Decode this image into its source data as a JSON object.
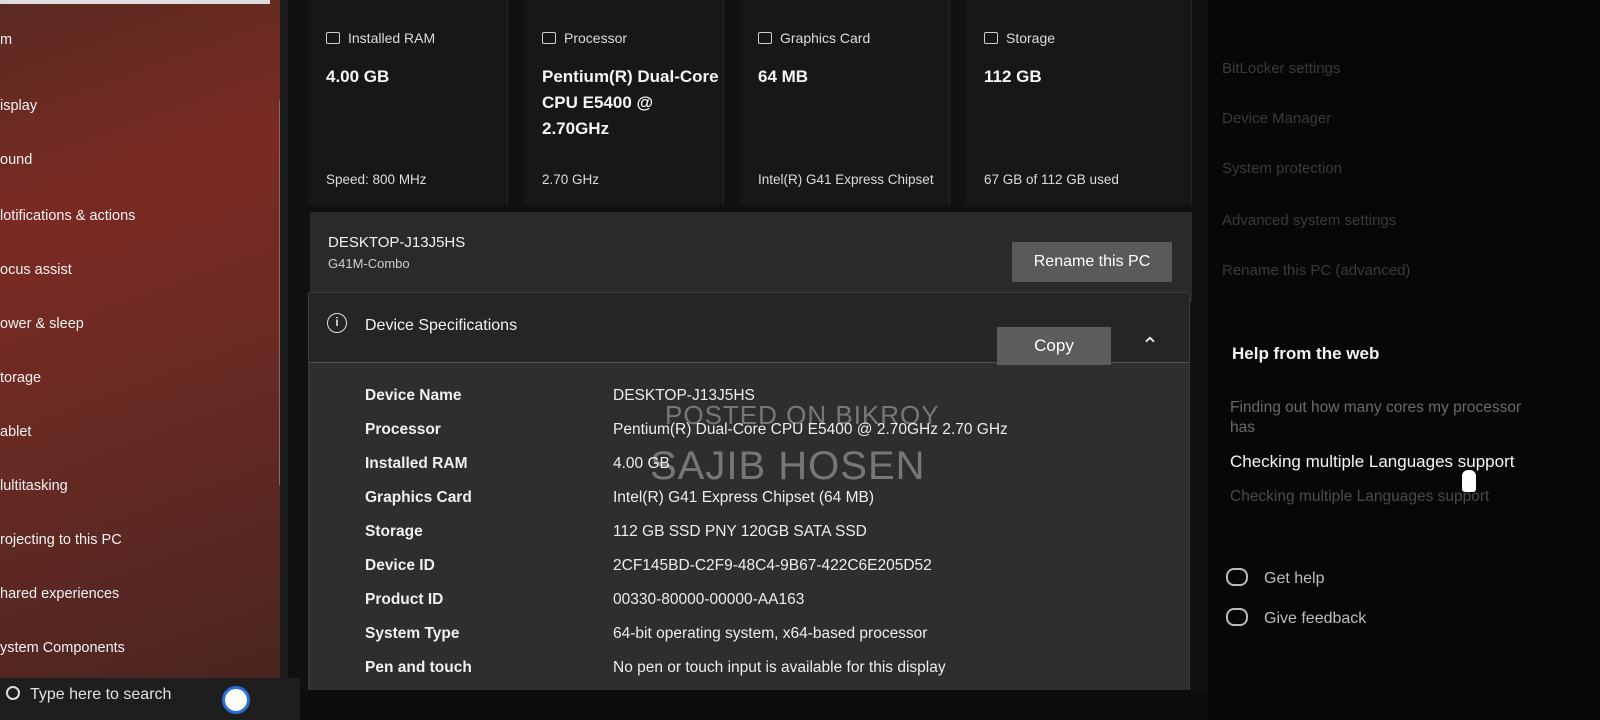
{
  "sidebar": {
    "items": [
      {
        "label": "m"
      },
      {
        "label": "isplay"
      },
      {
        "label": "ound"
      },
      {
        "label": "lotifications & actions"
      },
      {
        "label": "ocus assist"
      },
      {
        "label": "ower & sleep"
      },
      {
        "label": "torage"
      },
      {
        "label": "ablet"
      },
      {
        "label": "lultitasking"
      },
      {
        "label": "rojecting to this PC"
      },
      {
        "label": "hared experiences"
      },
      {
        "label": "ystem Components"
      }
    ]
  },
  "cards": [
    {
      "header": "Installed RAM",
      "value": "4.00 GB",
      "sub": "Speed: 800 MHz",
      "icon": "ram-icon"
    },
    {
      "header": "Processor",
      "value": "Pentium(R) Dual-Core CPU E5400 @ 2.70GHz",
      "sub": "2.70 GHz",
      "icon": "cpu-icon"
    },
    {
      "header": "Graphics Card",
      "value": "64 MB",
      "sub": "Intel(R) G41 Express Chipset",
      "icon": "gpu-icon"
    },
    {
      "header": "Storage",
      "value": "112 GB",
      "sub": "67 GB of 112 GB used",
      "icon": "storage-icon"
    }
  ],
  "pc": {
    "name": "DESKTOP-J13J5HS",
    "model": "G41M-Combo",
    "rename_label": "Rename this PC"
  },
  "specs": {
    "title": "Device Specifications",
    "copy_label": "Copy",
    "rows": [
      {
        "key": "Device Name",
        "value": "DESKTOP-J13J5HS"
      },
      {
        "key": "Processor",
        "value": "Pentium(R) Dual-Core  CPU     E5400  @ 2.70GHz   2.70 GHz"
      },
      {
        "key": "Installed RAM",
        "value": "4.00 GB"
      },
      {
        "key": "Graphics Card",
        "value": "Intel(R) G41 Express Chipset (64 MB)"
      },
      {
        "key": "Storage",
        "value": "112 GB SSD PNY 120GB SATA SSD"
      },
      {
        "key": "Device ID",
        "value": "2CF145BD-C2F9-48C4-9B67-422C6E205D52"
      },
      {
        "key": "Product ID",
        "value": "00330-80000-00000-AA163"
      },
      {
        "key": "System Type",
        "value": "64-bit operating system, x64-based processor"
      },
      {
        "key": "Pen and touch",
        "value": "No pen or touch input is available for this display"
      }
    ]
  },
  "right": {
    "faint_links": [
      "BitLocker settings",
      "Device Manager",
      "System protection",
      "Advanced system settings",
      "Rename this PC (advanced)"
    ],
    "help_title": "Help from the web",
    "links": [
      {
        "label": "Finding out how many cores my processor has"
      },
      {
        "label": "Checking multiple Languages support"
      },
      {
        "label": "Checking multiple Languages support"
      }
    ],
    "get_help": "Get help",
    "give_feedback": "Give feedback"
  },
  "taskbar": {
    "search_placeholder": "Type here to search"
  },
  "watermark": {
    "line1": "POSTED ON BIKROY",
    "line2": "SAJIB HOSEN"
  }
}
